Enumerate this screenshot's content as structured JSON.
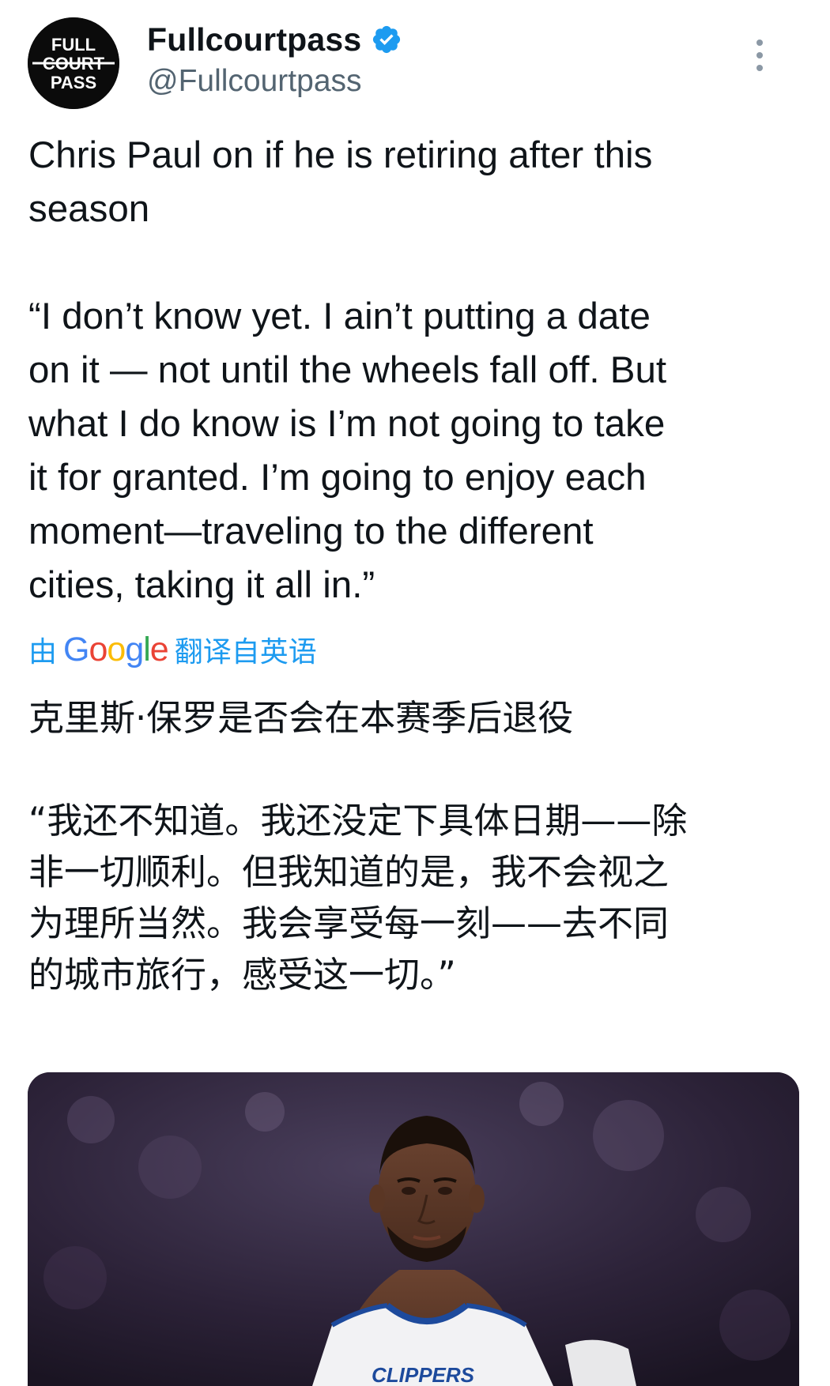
{
  "account": {
    "display_name": "Fullcourtpass",
    "handle": "@Fullcourtpass",
    "verified": true,
    "avatar_logo_lines": [
      "FULL",
      "COURT",
      "PASS"
    ]
  },
  "tweet": {
    "text": "Chris Paul on if he is retiring after this\nseason\n\n“I don’t know yet. I ain’t putting a date\non it — not until the wheels fall off. But\nwhat I do know is I’m not going to take\nit for granted. I’m going to enjoy each\nmoment—traveling to the different\ncities, taking it all in.”",
    "translation_prefix": "由",
    "translation_provider": "Google",
    "translation_suffix": "翻译自英语",
    "translated_text": "克里斯·保罗是否会在本赛季后退役\n\n“我还不知道。我还没定下具体日期——除\n非一切顺利。但我知道的是，我不会视之\n为理所当然。我会享受每一刻——去不同\n的城市旅行，感受这一切。”",
    "media_jersey_text": "CLIPPERS"
  },
  "icons": {
    "verified": "verified-badge-icon",
    "more": "more-vertical-icon"
  },
  "colors": {
    "text": "#0f1419",
    "secondary_text": "#536471",
    "link_blue": "#1d9bf0",
    "verified_blue": "#1d9bf0"
  }
}
